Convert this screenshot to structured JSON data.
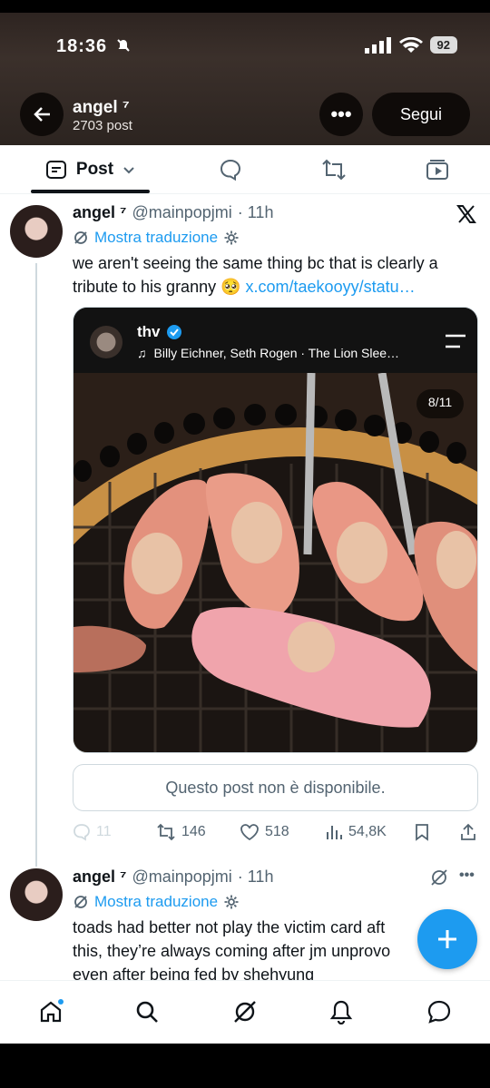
{
  "status": {
    "time": "18:36",
    "battery": "92"
  },
  "header": {
    "title": "angel ⁷",
    "post_count": "2703 post",
    "more_label": "•••",
    "follow_label": "Segui"
  },
  "tabs": {
    "post_label": "Post"
  },
  "post1": {
    "name": "angel ⁷",
    "handle": "@mainpopjmi",
    "time": "· 11h",
    "translate": "Mostra traduzione",
    "text": "we aren't seeing the same thing bc that is clearly a tribute to his granny 🥺",
    "link": "x.com/taekooyy/statu…",
    "embed": {
      "user": "thv",
      "music": "Billy Eichner, Seth Rogen · The Lion Slee…",
      "counter": "8/11"
    },
    "unavailable": "Questo post non è disponibile.",
    "stats": {
      "replies": "11",
      "reposts": "146",
      "likes": "518",
      "views": "54,8K"
    }
  },
  "post2": {
    "name": "angel ⁷",
    "handle": "@mainpopjmi",
    "time": "· 11h",
    "translate": "Mostra traduzione",
    "text_line1": "toads had better not play the victim card aft",
    "text_line2": "this, they’re always coming after jm unprovo",
    "text_line3": "even after being fed by shehyung"
  },
  "colors": {
    "accent": "#1d9bf0",
    "text": "#0f1419",
    "secondary": "#536471"
  }
}
